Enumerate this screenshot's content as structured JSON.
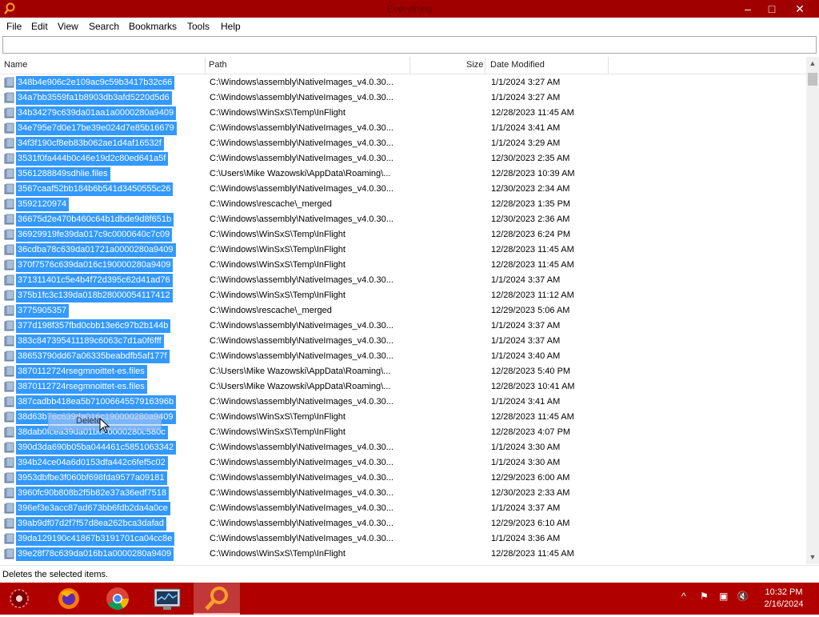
{
  "window": {
    "title": "Everything",
    "minimize": "–",
    "maximize": "□",
    "close": "✕"
  },
  "menu": [
    "File",
    "Edit",
    "View",
    "Search",
    "Bookmarks",
    "Tools",
    "Help"
  ],
  "search": {
    "value": "",
    "placeholder": ""
  },
  "columns": {
    "name": "Name",
    "path": "Path",
    "size": "Size",
    "date": "Date Modified"
  },
  "rows": [
    {
      "name": "348b4e906c2e109ac9c59b3417b32c66",
      "path": "C:\\Windows\\assembly\\NativeImages_v4.0.30...",
      "size": "",
      "date": "1/1/2024 3:27 AM"
    },
    {
      "name": "34a7bb3559fa1b8903db3afd5220d5d6",
      "path": "C:\\Windows\\assembly\\NativeImages_v4.0.30...",
      "size": "",
      "date": "1/1/2024 3:27 AM"
    },
    {
      "name": "34b34279c639da01aa1a0000280a9409",
      "path": "C:\\Windows\\WinSxS\\Temp\\InFlight",
      "size": "",
      "date": "12/28/2023 11:45 AM"
    },
    {
      "name": "34e795e7d0e17be39e024d7e85b16679",
      "path": "C:\\Windows\\assembly\\NativeImages_v4.0.30...",
      "size": "",
      "date": "1/1/2024 3:41 AM"
    },
    {
      "name": "34f3f190cf8eb83b062ae1d4af16532f",
      "path": "C:\\Windows\\assembly\\NativeImages_v4.0.30...",
      "size": "",
      "date": "1/1/2024 3:29 AM"
    },
    {
      "name": "3531f0fa444b0c46e19d2c80ed641a5f",
      "path": "C:\\Windows\\assembly\\NativeImages_v4.0.30...",
      "size": "",
      "date": "12/30/2023 2:35 AM"
    },
    {
      "name": "3561288849sdhlie.files",
      "path": "C:\\Users\\Mike Wazowski\\AppData\\Roaming\\...",
      "size": "",
      "date": "12/28/2023 10:39 AM"
    },
    {
      "name": "3567caaf52bb184b6b541d3450555c26",
      "path": "C:\\Windows\\assembly\\NativeImages_v4.0.30...",
      "size": "",
      "date": "12/30/2023 2:34 AM"
    },
    {
      "name": "3592120974",
      "path": "C:\\Windows\\rescache\\_merged",
      "size": "",
      "date": "12/28/2023 1:35 PM"
    },
    {
      "name": "36675d2e470b460c64b1dbde9d8f651b",
      "path": "C:\\Windows\\assembly\\NativeImages_v4.0.30...",
      "size": "",
      "date": "12/30/2023 2:36 AM"
    },
    {
      "name": "36929919fe39da017c9c0000640c7c09",
      "path": "C:\\Windows\\WinSxS\\Temp\\InFlight",
      "size": "",
      "date": "12/28/2023 6:24 PM"
    },
    {
      "name": "36cdba78c639da01721a0000280a9409",
      "path": "C:\\Windows\\WinSxS\\Temp\\InFlight",
      "size": "",
      "date": "12/28/2023 11:45 AM"
    },
    {
      "name": "370f7576c639da016c190000280a9409",
      "path": "C:\\Windows\\WinSxS\\Temp\\InFlight",
      "size": "",
      "date": "12/28/2023 11:45 AM"
    },
    {
      "name": "371311401c5e4b4f72d395c62d41ad76",
      "path": "C:\\Windows\\assembly\\NativeImages_v4.0.30...",
      "size": "",
      "date": "1/1/2024 3:37 AM"
    },
    {
      "name": "375b1fc3c139da018b28000054117412",
      "path": "C:\\Windows\\WinSxS\\Temp\\InFlight",
      "size": "",
      "date": "12/28/2023 11:12 AM"
    },
    {
      "name": "3775905357",
      "path": "C:\\Windows\\rescache\\_merged",
      "size": "",
      "date": "12/29/2023 5:06 AM"
    },
    {
      "name": "377d198f357fbd0cbb13e6c97b2b144b",
      "path": "C:\\Windows\\assembly\\NativeImages_v4.0.30...",
      "size": "",
      "date": "1/1/2024 3:37 AM"
    },
    {
      "name": "383c847395411189c6063c7d1a0f6fff",
      "path": "C:\\Windows\\assembly\\NativeImages_v4.0.30...",
      "size": "",
      "date": "1/1/2024 3:37 AM"
    },
    {
      "name": "38653790dd67a06335beabdfb5af177f",
      "path": "C:\\Windows\\assembly\\NativeImages_v4.0.30...",
      "size": "",
      "date": "1/1/2024 3:40 AM"
    },
    {
      "name": "3870112724rsegmnoittet-es.files",
      "path": "C:\\Users\\Mike Wazowski\\AppData\\Roaming\\...",
      "size": "",
      "date": "12/28/2023 5:40 PM"
    },
    {
      "name": "3870112724rsegmnoittet-es.files",
      "path": "C:\\Users\\Mike Wazowski\\AppData\\Roaming\\...",
      "size": "",
      "date": "12/28/2023 10:41 AM"
    },
    {
      "name": "387cadbb418ea5b7100664557916396b",
      "path": "C:\\Windows\\assembly\\NativeImages_v4.0.30...",
      "size": "",
      "date": "1/1/2024 3:41 AM"
    },
    {
      "name": "38d63b76c639da016c190000280a9409",
      "path": "C:\\Windows\\WinSxS\\Temp\\InFlight",
      "size": "",
      "date": "12/28/2023 11:45 AM"
    },
    {
      "name": "38dab0fcea39da01b040000280c580c",
      "path": "C:\\Windows\\WinSxS\\Temp\\InFlight",
      "size": "",
      "date": "12/28/2023 4:07 PM"
    },
    {
      "name": "390d3da690b05ba044461c5851063342",
      "path": "C:\\Windows\\assembly\\NativeImages_v4.0.30...",
      "size": "",
      "date": "1/1/2024 3:30 AM"
    },
    {
      "name": "394b24ce04a6d0153dfa442c6fef5c02",
      "path": "C:\\Windows\\assembly\\NativeImages_v4.0.30...",
      "size": "",
      "date": "1/1/2024 3:30 AM"
    },
    {
      "name": "3953dbfbe3f060bf698fda9577a09181",
      "path": "C:\\Windows\\assembly\\NativeImages_v4.0.30...",
      "size": "",
      "date": "12/29/2023 6:00 AM"
    },
    {
      "name": "3960fc90b808b2f5b82e37a36edf7518",
      "path": "C:\\Windows\\assembly\\NativeImages_v4.0.30...",
      "size": "",
      "date": "12/30/2023 2:33 AM"
    },
    {
      "name": "396ef3e3acc87ad673bb6fdb2da4a0ce",
      "path": "C:\\Windows\\assembly\\NativeImages_v4.0.30...",
      "size": "",
      "date": "1/1/2024 3:37 AM"
    },
    {
      "name": "39ab9df07d2f7f57d8ea262bca3dafad",
      "path": "C:\\Windows\\assembly\\NativeImages_v4.0.30...",
      "size": "",
      "date": "12/29/2023 6:10 AM"
    },
    {
      "name": "39da129190c41867b3191701ca04cc8e",
      "path": "C:\\Windows\\assembly\\NativeImages_v4.0.30...",
      "size": "",
      "date": "1/1/2024 3:36 AM"
    },
    {
      "name": "39e28f78c639da016b1a0000280a9409",
      "path": "C:\\Windows\\WinSxS\\Temp\\InFlight",
      "size": "",
      "date": "12/28/2023 11:45 AM"
    }
  ],
  "drag": {
    "label": "Delete"
  },
  "status": {
    "text": "Deletes the selected items."
  },
  "taskbar": {
    "apps": [
      {
        "name": "start-icon"
      },
      {
        "name": "firefox-icon"
      },
      {
        "name": "chrome-icon"
      },
      {
        "name": "system-monitor-icon"
      },
      {
        "name": "everything-search-icon",
        "active": true
      }
    ],
    "tray": {
      "chevron": "^",
      "flag": "⚑",
      "network": "▣",
      "volume": "🔇"
    },
    "clock": {
      "time": "10:32 PM",
      "date": "2/16/2024"
    }
  },
  "colors": {
    "titlebar": "#a10000",
    "taskbar": "#b00000",
    "selection": "#3399ff"
  }
}
